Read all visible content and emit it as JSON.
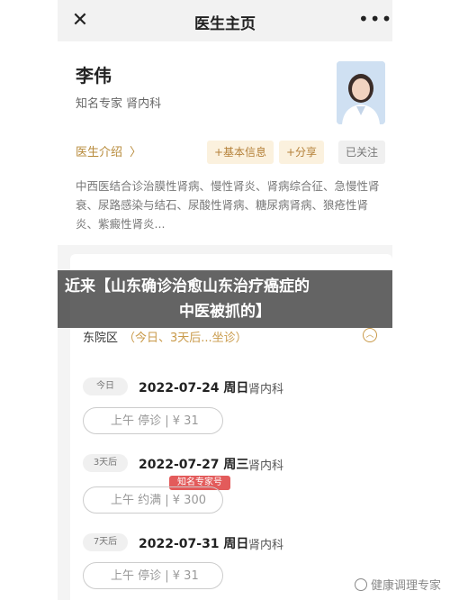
{
  "header": {
    "title": "医生主页",
    "close_icon": "close-icon",
    "more_icon": "more-icon",
    "close_glyph": "✕",
    "more_glyph": "•••"
  },
  "doctor": {
    "name": "李伟",
    "title_line": "知名专家  肾内科",
    "intro_link": "医生介绍",
    "intro_chevron": "〉",
    "buttons": {
      "basic_info": "+基本信息",
      "share": "+分享",
      "followed": "已关注"
    },
    "specialty": "中西医结合诊治膜性肾病、慢性肾炎、肾病综合征、急慢性肾衰、尿路感染与结石、尿酸性肾病、糖尿病肾病、狼疮性肾炎、紫癜性肾炎..."
  },
  "caption": {
    "line1": "近来【山东确诊治愈山东治疗癌症的",
    "line2": "中医被抓的】"
  },
  "schedule": {
    "campus": "东院区",
    "campus_sub": "（今日、3天后...坐诊）",
    "days": [
      {
        "badge": "今日",
        "date": "2022-07-24 周日",
        "dept": "肾内科",
        "slot": "上午 停诊 | ¥ 31",
        "tag": ""
      },
      {
        "badge": "3天后",
        "date": "2022-07-27 周三",
        "dept": "肾内科",
        "slot": "上午 约满 | ¥ 300",
        "tag": "知名专家号"
      },
      {
        "badge": "7天后",
        "date": "2022-07-31 周日",
        "dept": "肾内科",
        "slot": "上午 停诊 | ¥ 31",
        "tag": ""
      }
    ]
  },
  "watermark": "健康调理专家",
  "colors": {
    "accent": "#c99a4a",
    "tag_bg": "#fbf1de",
    "badge_red": "#e35b5b"
  }
}
